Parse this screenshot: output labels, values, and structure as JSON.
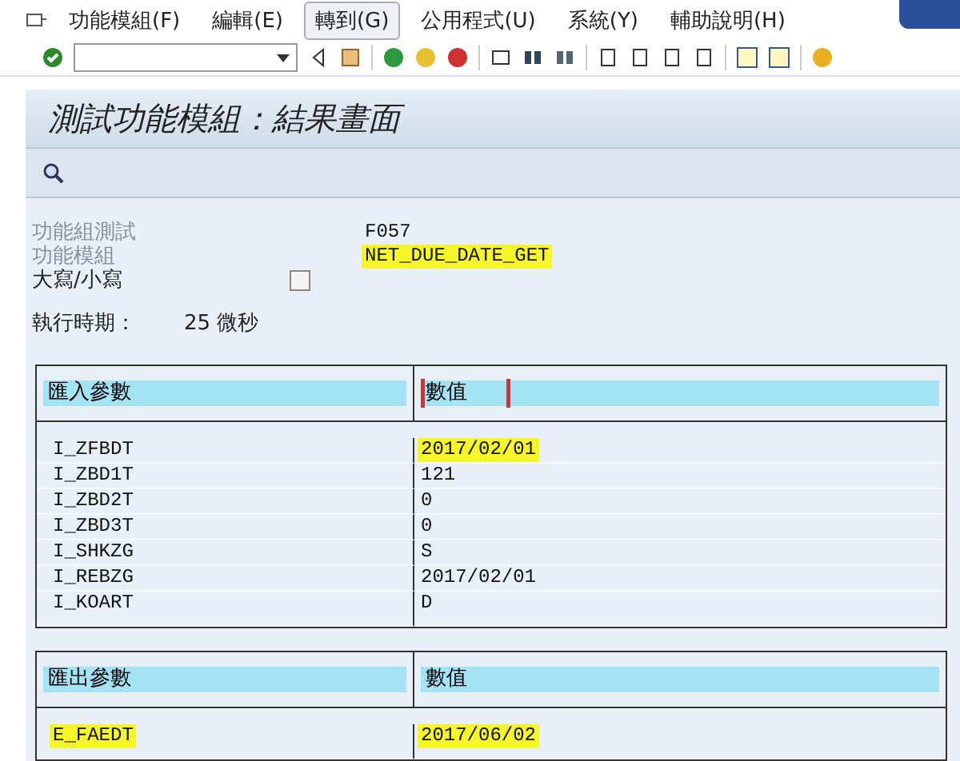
{
  "menu": [
    {
      "label": "功能模組(F)",
      "selected": false
    },
    {
      "label": "編輯(E)",
      "selected": false
    },
    {
      "label": "轉到(G)",
      "selected": true
    },
    {
      "label": "公用程式(U)",
      "selected": false
    },
    {
      "label": "系統(Y)",
      "selected": false
    },
    {
      "label": "輔助說明(H)",
      "selected": false
    }
  ],
  "title": "測試功能模組：結果畫面",
  "fields": [
    {
      "label": "功能組測試",
      "value": "F057",
      "highlighted": false,
      "kind": "text"
    },
    {
      "label": "功能模組",
      "value": "NET_DUE_DATE_GET",
      "highlighted": true,
      "kind": "text"
    },
    {
      "label": "大寫/小寫",
      "checked": false,
      "kind": "checkbox"
    }
  ],
  "runtime": {
    "label": "執行時期：",
    "value": "25 微秒"
  },
  "import_table": {
    "columns": [
      {
        "label": "匯入參數",
        "focused": false
      },
      {
        "label": "數值",
        "focused": true
      }
    ],
    "rows": [
      {
        "name": "I_ZFBDT",
        "value": "2017/02/01",
        "name_highlighted": false,
        "value_highlighted": true
      },
      {
        "name": "I_ZBD1T",
        "value": "121",
        "name_highlighted": false,
        "value_highlighted": false
      },
      {
        "name": "I_ZBD2T",
        "value": "0",
        "name_highlighted": false,
        "value_highlighted": false
      },
      {
        "name": "I_ZBD3T",
        "value": "0",
        "name_highlighted": false,
        "value_highlighted": false
      },
      {
        "name": "I_SHKZG",
        "value": "S",
        "name_highlighted": false,
        "value_highlighted": false
      },
      {
        "name": "I_REBZG",
        "value": "2017/02/01",
        "name_highlighted": false,
        "value_highlighted": false
      },
      {
        "name": "I_KOART",
        "value": "D",
        "name_highlighted": false,
        "value_highlighted": false
      }
    ]
  },
  "export_table": {
    "columns": [
      {
        "label": "匯出參數",
        "focused": false
      },
      {
        "label": "數值",
        "focused": false
      }
    ],
    "rows": [
      {
        "name": "E_FAEDT",
        "value": "2017/06/02",
        "name_highlighted": true,
        "value_highlighted": true
      }
    ]
  }
}
